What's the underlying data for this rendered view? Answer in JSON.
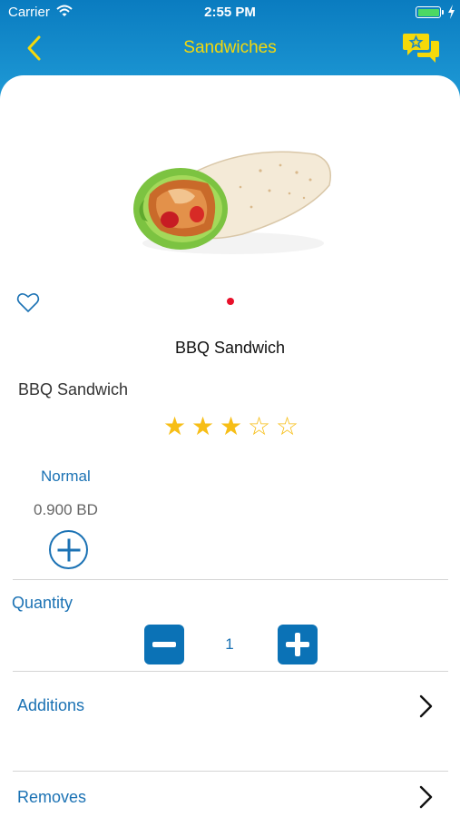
{
  "status_bar": {
    "carrier": "Carrier",
    "time": "2:55 PM",
    "icons": [
      "wifi-icon",
      "battery-icon",
      "charging-bolt-icon"
    ]
  },
  "nav": {
    "title": "Sandwiches",
    "back_icon": "chevron-left-icon",
    "action_icon": "review-chat-star-icon"
  },
  "colors": {
    "header_gradient_top": "#0a7cc0",
    "header_gradient_bottom": "#1f9ad6",
    "nav_title": "#f5d90a",
    "accent_blue": "#1b72b4",
    "button_blue": "#0b72b6",
    "star": "#f7be16",
    "page_dot": "#e8102a"
  },
  "product": {
    "image_icon": "chicken-wrap-image",
    "favorite_icon": "heart-outline-icon",
    "title": "BBQ Sandwich",
    "description": "BBQ Sandwich",
    "rating": {
      "value": 3,
      "max": 5,
      "stars": [
        "★",
        "★",
        "★",
        "☆",
        "☆"
      ]
    }
  },
  "sizes": [
    {
      "label": "Normal",
      "price": "0.900 BD",
      "add_icon": "plus-circle-icon"
    }
  ],
  "quantity": {
    "label": "Quantity",
    "value": "1",
    "minus_icon": "minus-icon",
    "plus_icon": "plus-icon"
  },
  "sections": [
    {
      "label": "Additions",
      "icon": "chevron-right-icon"
    },
    {
      "label": "Removes",
      "icon": "chevron-right-icon"
    }
  ]
}
